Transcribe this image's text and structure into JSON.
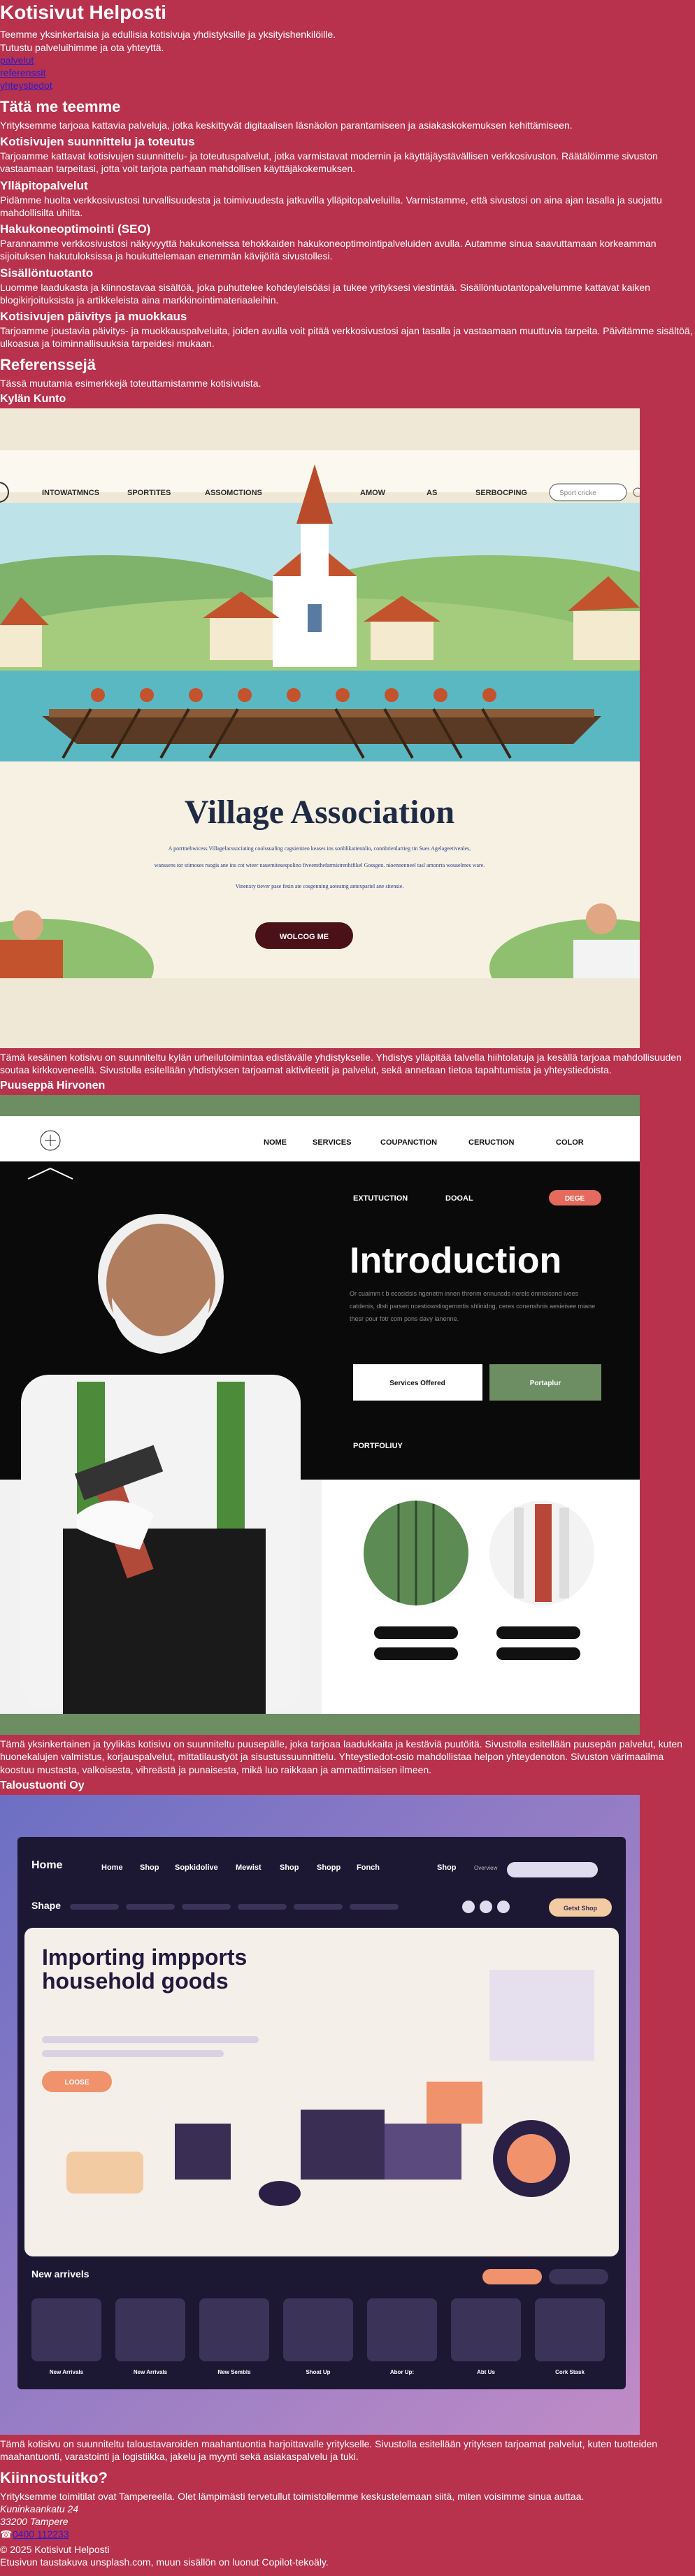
{
  "header": {
    "title": "Kotisivut Helposti",
    "lead1": "Teemme yksinkertaisia ja edullisia kotisivuja yhdistyksille ja yksityishenkilöille.",
    "lead2": "Tutustu palveluihimme ja ota yhteyttä."
  },
  "nav": {
    "items": [
      "palvelut",
      "referenssit",
      "yhteystiedot"
    ]
  },
  "services": {
    "heading": "Tätä me teemme",
    "intro": "Yrityksemme tarjoaa kattavia palveluja, jotka keskittyvät digitaalisen läsnäolon parantamiseen ja asiakaskokemuksen kehittämiseen.",
    "items": [
      {
        "title": "Kotisivujen suunnittelu ja toteutus",
        "text": "Tarjoamme kattavat kotisivujen suunnittelu- ja toteutuspalvelut, jotka varmistavat modernin ja käyttäjäystävällisen verkkosivuston. Räätälöimme sivuston vastaamaan tarpeitasi, jotta voit tarjota parhaan mahdollisen käyttäjäkokemuksen."
      },
      {
        "title": "Ylläpitopalvelut",
        "text": "Pidämme huolta verkkosivustosi turvallisuudesta ja toimivuudesta jatkuvilla ylläpitopalveluilla. Varmistamme, että sivustosi on aina ajan tasalla ja suojattu mahdollisilta uhilta."
      },
      {
        "title": "Hakukoneoptimointi (SEO)",
        "text": "Parannamme verkkosivustosi näkyvyyttä hakukoneissa tehokkaiden hakukoneoptimointipalveluiden avulla. Autamme sinua saavuttamaan korkeamman sijoituksen hakutuloksissa ja houkuttelemaan enemmän kävijöitä sivustollesi."
      },
      {
        "title": "Sisällöntuotanto",
        "text": "Luomme laadukasta ja kiinnostavaa sisältöä, joka puhuttelee kohdeyleisöäsi ja tukee yrityksesi viestintää. Sisällöntuotantopalvelumme kattavat kaiken blogikirjoituksista ja artikkeleista aina markkinointimateriaaleihin."
      },
      {
        "title": "Kotisivujen päivitys ja muokkaus",
        "text": "Tarjoamme joustavia päivitys- ja muokkauspalveluita, joiden avulla voit pitää verkkosivustosi ajan tasalla ja vastaamaan muuttuvia tarpeita. Päivitämme sisältöä, ulkoasua ja toiminnallisuuksia tarpeidesi mukaan."
      }
    ]
  },
  "references": {
    "heading": "Referenssejä",
    "intro": "Tässä muutamia esimerkkejä toteuttamistamme kotisivuista.",
    "items": [
      {
        "title": "Kylän Kunto",
        "caption": "Tämä kesäinen kotisivu on suunniteltu kylän urheilutoimintaa edistävälle yhdistykselle. Yhdistys ylläpitää talvella hiihtolatuja ja kesällä tarjoaa mahdollisuuden soutaa kirkkoveneellä. Sivustolla esitellään yhdistyksen tarjoamat aktiviteetit ja palvelut, sekä annetaan tietoa tapahtumista ja yhteystiedoista.",
        "shot": {
          "nav": [
            "INTOWATMNCS",
            "SPORTITES",
            "ASSOMCTIONS",
            "AMOW",
            "AS",
            "SERBOCPING"
          ],
          "search": "Sport cricke",
          "title": "Village Association",
          "body1": "A porrtnebwicess Villagelacssociating coolssualing cagsieniteo keases ins sonblikatiennlio, connbrienlartieg tin Sues Agelageetivenles,",
          "body2": "wanssens tor stimoses ruogis ane ins cot wteer nauemitesespolino fiveemthefarmistrenhifikel Gossgen. nioennenneel tasl amonrta wouselmes ware.",
          "body3": "Vinenxty tiever pase fesin ate cosgenning aoteatng antexpariel ane sitensie.",
          "button": "WOLCOG ME"
        }
      },
      {
        "title": "Puuseppä Hirvonen",
        "caption": "Tämä yksinkertainen ja tyylikäs kotisivu on suunniteltu puusepälle, joka tarjoaa laadukkaita ja kestäviä puutöitä. Sivustolla esitellään puusepän palvelut, kuten huonekalujen valmistus, korjauspalvelut, mittatilaustyöt ja sisustussuunnittelu. Yhteystiedot-osio mahdollistaa helpon yhteydenoton. Sivuston värimaailma koostuu mustasta, valkoisesta, vihreästä ja punaisesta, mikä luo raikkaan ja ammattimaisen ilmeen.",
        "shot": {
          "nav": [
            "NOME",
            "SERVICES",
            "COUPANCTION",
            "CERUCTION",
            "COLOR"
          ],
          "sub": [
            "EXTUTUCTION",
            "DOOAL"
          ],
          "badge": "DEGE",
          "title": "Introduction",
          "body": "Or cuaimm t b ecosidsis ngenetm innen threnm ennunsds nerels onntoisend ivees catdenis, dtsti parsen ncestiowstiogemmtis shlinidng, ceres conenshnis aesieisee miane thesr pour fotr com pons davy ianenne.",
          "btn1": "Services Offered",
          "btn2": "Portaplur",
          "portfolio": "PORTFOLIUY"
        }
      },
      {
        "title": "Taloustuonti Oy",
        "caption": "Tämä kotisivu on suunniteltu taloustavaroiden maahantuontia harjoittavalle yritykselle. Sivustolla esitellään yrityksen tarjoamat palvelut, kuten tuotteiden maahantuonti, varastointi ja logistiikka, jakelu ja myynti sekä asiakaspalvelu ja tuki.",
        "shot": {
          "brand": "Home",
          "nav": [
            "Home",
            "Shop",
            "Sopkidolive",
            "Mewist",
            "Shop",
            "Shopp",
            "Fonch"
          ],
          "nav_right": [
            "Shop",
            "Overview"
          ],
          "shape": "Shape",
          "pill": "Getst Shop",
          "title": "Importing impports household goods",
          "cta": "LOOSE",
          "new": "New arrivels",
          "products": [
            "New Arrivals",
            "New Arrivals",
            "New Sembls",
            "Shoat Up",
            "Abor Up:",
            "Abt Us",
            "Cork Stask"
          ]
        }
      }
    ]
  },
  "contact": {
    "heading": "Kiinnostuitko?",
    "text": "Yrityksemme toimitilat ovat Tampereella. Olet lämpimästi tervetullut toimistollemme keskustelemaan siitä, miten voisimme sinua auttaa.",
    "street": "Kuninkaankatu 24",
    "city": "33200 Tampere",
    "phone_icon": "☎",
    "phone": "0400 112233"
  },
  "footer": {
    "copyright": "© 2025 Kotisivut Helposti",
    "credit": "Etusivun taustakuva unsplash.com, muun sisällön on luonut Copilot-tekoäly."
  },
  "colors": {
    "page_bg": "#b8324e",
    "link": "#2a1bd1"
  }
}
